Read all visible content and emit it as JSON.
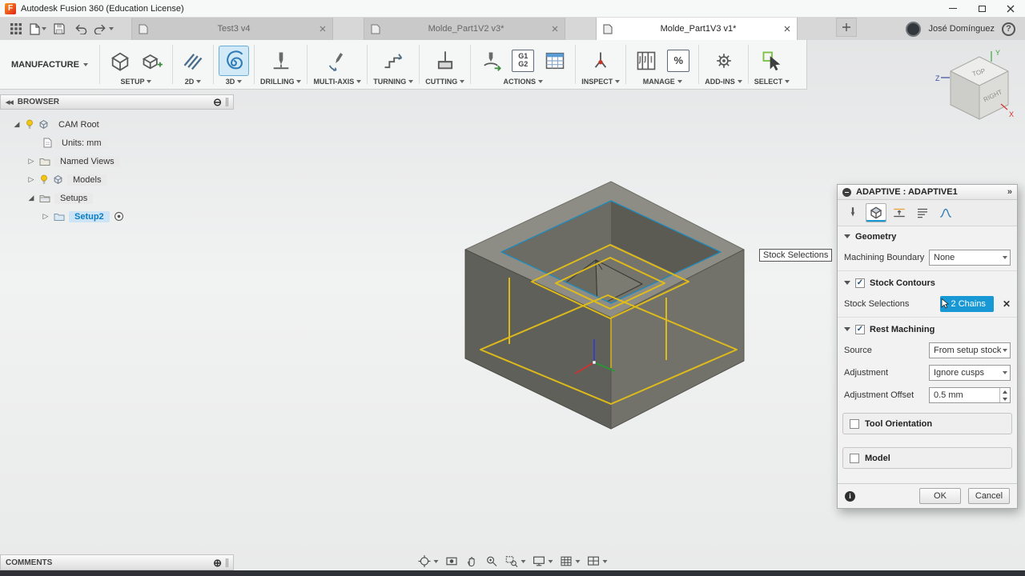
{
  "app": {
    "title": "Autodesk Fusion 360 (Education License)"
  },
  "tabs": {
    "items": [
      {
        "label": "Test3 v4"
      },
      {
        "label": "Molde_Part1V2 v3*"
      },
      {
        "label": "Molde_Part1V3 v1*"
      }
    ],
    "user_name": "José Domínguez"
  },
  "ribbon": {
    "workspace": "MANUFACTURE",
    "setup": "SETUP",
    "d2": "2D",
    "d3": "3D",
    "drilling": "DRILLING",
    "multi_axis": "MULTI-AXIS",
    "turning": "TURNING",
    "cutting": "CUTTING",
    "actions": "ACTIONS",
    "inspect": "INSPECT",
    "manage": "MANAGE",
    "add_ins": "ADD-INS",
    "select": "SELECT",
    "g1": "G1",
    "g2": "G2",
    "percent": "%"
  },
  "browser": {
    "header": "BROWSER",
    "cam_root": "CAM Root",
    "units": "Units: mm",
    "named_views": "Named Views",
    "models": "Models",
    "setups": "Setups",
    "setup2": "Setup2"
  },
  "viewport": {
    "tooltip": "Stock Selections",
    "viewcube": {
      "top": "TOP",
      "right": "RIGHT",
      "x": "X",
      "y": "Y",
      "z": "Z"
    }
  },
  "dialog": {
    "title": "ADAPTIVE : ADAPTIVE1",
    "geometry_header": "Geometry",
    "machining_boundary_label": "Machining Boundary",
    "machining_boundary_value": "None",
    "stock_contours_header": "Stock Contours",
    "stock_selections_label": "Stock Selections",
    "chains_button": "2 Chains",
    "rest_machining_header": "Rest Machining",
    "source_label": "Source",
    "source_value": "From setup stock",
    "adjustment_label": "Adjustment",
    "adjustment_value": "Ignore cusps",
    "offset_label": "Adjustment Offset",
    "offset_value": "0.5 mm",
    "tool_orientation_header": "Tool Orientation",
    "model_header": "Model",
    "ok": "OK",
    "cancel": "Cancel"
  },
  "comments": {
    "header": "COMMENTS"
  },
  "colors": {
    "accent_blue": "#1899d5",
    "toolpath_yellow": "#e4bf16",
    "selection_text": "#0a7ec2"
  }
}
